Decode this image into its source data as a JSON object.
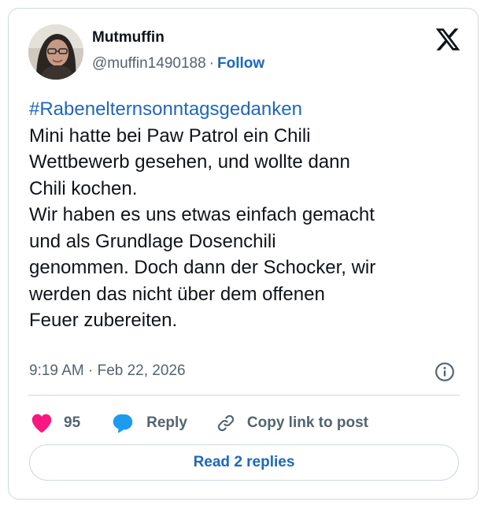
{
  "author": {
    "name": "Mutmuffin",
    "handle": "@muffin1490188",
    "separator": "·",
    "follow_label": "Follow",
    "avatar_icon": "profile-photo"
  },
  "platform_icon": "x-logo",
  "tweet": {
    "hashtag": "#Rabenelternsonntagsgedanken",
    "lines": [
      "Mini hatte bei Paw Patrol ein Chili",
      "Wettbewerb gesehen, und wollte dann",
      "Chili kochen.",
      "Wir haben es uns etwas einfach gemacht",
      "und als Grundlage Dosenchili",
      "genommen. Doch dann der Schocker, wir",
      "werden das nicht über dem offenen",
      "Feuer zubereiten."
    ],
    "timestamp": "9:19 AM · Feb 22, 2026"
  },
  "actions": {
    "like_count": "95",
    "reply_label": "Reply",
    "copy_label": "Copy link to post"
  },
  "read_replies_label": "Read 2 replies",
  "colors": {
    "link": "#1d67c4",
    "heart": "#f91880",
    "reply_bubble": "#1d9bf0",
    "muted": "#536471",
    "border": "#cfd9de"
  }
}
